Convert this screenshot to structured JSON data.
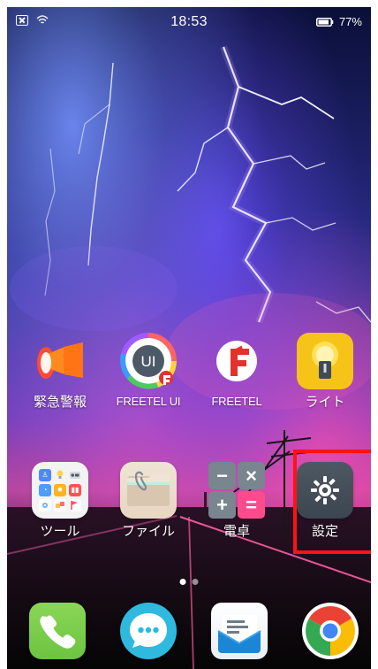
{
  "status_bar": {
    "time": "18:53",
    "battery": "77%",
    "icons": [
      "sim-icon",
      "wifi-icon",
      "battery-icon"
    ]
  },
  "home": {
    "row1": [
      {
        "label": "緊急警報",
        "icon": "megaphone-icon"
      },
      {
        "label": "FREETEL UI",
        "icon": "freetel-ui-icon"
      },
      {
        "label": "FREETEL",
        "icon": "freetel-icon"
      },
      {
        "label": "ライト",
        "icon": "flashlight-icon"
      }
    ],
    "row2": [
      {
        "label": "ツール",
        "icon": "tools-folder-icon"
      },
      {
        "label": "ファイル",
        "icon": "file-icon"
      },
      {
        "label": "電卓",
        "icon": "calculator-icon"
      },
      {
        "label": "設定",
        "icon": "settings-icon"
      }
    ],
    "freetel_ui_text": "UI"
  },
  "page_indicator": {
    "count": 2,
    "active_index": 1
  },
  "dock": [
    {
      "name": "phone",
      "icon": "phone-icon"
    },
    {
      "name": "messages",
      "icon": "message-icon"
    },
    {
      "name": "mail",
      "icon": "mail-icon"
    },
    {
      "name": "chrome",
      "icon": "chrome-icon"
    }
  ],
  "colors": {
    "highlight": "#ff1212",
    "flashlight_bg": "#f6c418",
    "settings_bg": "#46505a",
    "calculator_pink": "#ff4b8b",
    "calculator_gray": "#79858f",
    "dock_phone": "#79cd4b",
    "dock_message": "#2fb9df",
    "dock_mail_blue": "#1a86d5"
  }
}
